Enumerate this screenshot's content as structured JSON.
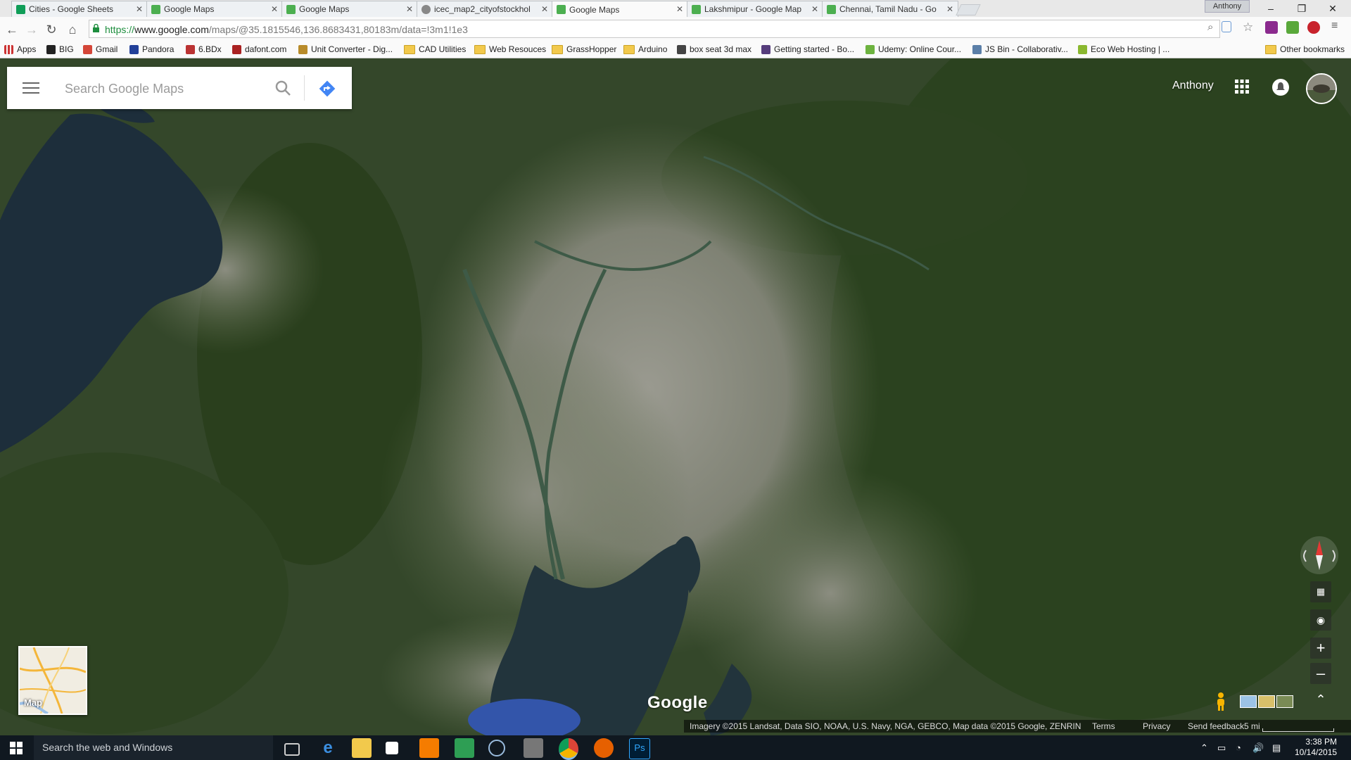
{
  "browser": {
    "tabs": [
      {
        "title": "Cities - Google Sheets",
        "icon": "sheets-icon",
        "color": "#0f9d58"
      },
      {
        "title": "Google Maps",
        "icon": "maps-icon",
        "color": "#4caf50"
      },
      {
        "title": "Google Maps",
        "icon": "maps-icon",
        "color": "#4caf50"
      },
      {
        "title": "icec_map2_cityofstockhol",
        "icon": "doc-icon",
        "color": "#888888"
      },
      {
        "title": "Google Maps",
        "icon": "maps-icon",
        "color": "#4caf50",
        "active": true
      },
      {
        "title": "Lakshmipur - Google Map",
        "icon": "maps-icon",
        "color": "#4caf50"
      },
      {
        "title": "Chennai, Tamil Nadu - Go",
        "icon": "maps-icon",
        "color": "#4caf50"
      }
    ],
    "profile_name": "Anthony",
    "window_controls": {
      "minimize": "–",
      "restore": "❐",
      "close": "✕"
    },
    "url_protocol": "https://",
    "url_domain": "www.google.com",
    "url_rest": "/maps/@35.1815546,136.8683431,80183m/data=!3m1!1e3",
    "bookmarks": [
      {
        "label": "Apps",
        "icon": "apps-grid-icon"
      },
      {
        "label": "BIG",
        "icon": "big-icon"
      },
      {
        "label": "Gmail",
        "icon": "gmail-icon"
      },
      {
        "label": "Pandora",
        "icon": "pandora-icon"
      },
      {
        "label": "6.BDx",
        "icon": "bookmark-icon"
      },
      {
        "label": "dafont.com",
        "icon": "dafont-icon"
      },
      {
        "label": "Unit Converter - Dig...",
        "icon": "converter-icon"
      },
      {
        "label": "CAD Utilities",
        "icon": "folder-icon"
      },
      {
        "label": "Web Resouces",
        "icon": "folder-icon"
      },
      {
        "label": "GrassHopper",
        "icon": "folder-icon"
      },
      {
        "label": "Arduino",
        "icon": "folder-icon"
      },
      {
        "label": "box seat 3d max",
        "icon": "bookmark-icon"
      },
      {
        "label": "Getting started - Bo...",
        "icon": "bootstrap-icon"
      },
      {
        "label": "Udemy: Online Cour...",
        "icon": "udemy-icon"
      },
      {
        "label": "JS Bin - Collaborativ...",
        "icon": "jsbin-icon"
      },
      {
        "label": "Eco Web Hosting | ...",
        "icon": "eco-icon"
      }
    ],
    "other_bookmarks": "Other bookmarks"
  },
  "maps": {
    "search_placeholder": "Search Google Maps",
    "user_name": "Anthony",
    "minimap_label": "Map",
    "logo_text": "Google",
    "zoom_in": "+",
    "zoom_out": "–",
    "attribution": "Imagery ©2015 Landsat, Data SIO, NOAA, U.S. Navy, NGA, GEBCO, Map data ©2015 Google, ZENRIN",
    "terms": "Terms",
    "privacy": "Privacy",
    "send_feedback": "Send feedback",
    "scale": "5 mi"
  },
  "taskbar": {
    "search_placeholder": "Search the web and Windows",
    "time": "3:38 PM",
    "date": "10/14/2015"
  },
  "colors": {
    "accent_blue": "#4285f4",
    "forest": "#2f4a22",
    "urban": "#8a8c84",
    "water": "#1e2f3a"
  }
}
